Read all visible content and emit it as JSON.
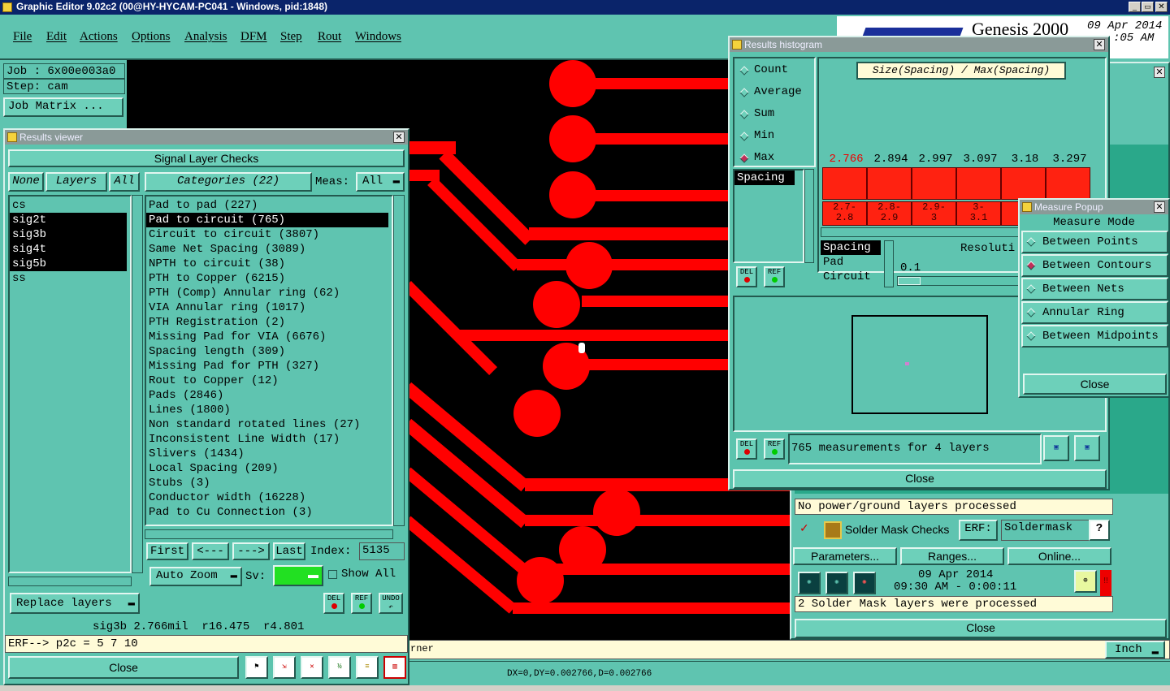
{
  "app": {
    "title": "Graphic Editor 9.02c2 (00@HY-HYCAM-PC041 - Windows, pid:1848)",
    "menu": [
      "File",
      "Edit",
      "Actions",
      "Options",
      "Analysis",
      "DFM",
      "Step",
      "Rout",
      "Windows"
    ],
    "brand": "Genesis 2000",
    "date": "09 Apr 2014",
    "time": ":05 AM",
    "job": "Job : 6x00e003a0",
    "step": "Step: cam",
    "job_matrix": "Job Matrix ...",
    "status_corner": "rner",
    "status_coords": "DX=0,DY=0.002766,D=0.002766",
    "units": "Inch"
  },
  "results_viewer": {
    "title": "Results viewer",
    "header": "Signal Layer Checks",
    "tabs": {
      "none": "None",
      "layers": "Layers",
      "all": "All"
    },
    "categories_label": "Categories (22)",
    "meas_label": "Meas:",
    "meas_value": "All",
    "layers": [
      {
        "name": "cs",
        "selected": false
      },
      {
        "name": "sig2t",
        "selected": true
      },
      {
        "name": "sig3b",
        "selected": true
      },
      {
        "name": "sig4t",
        "selected": true
      },
      {
        "name": "sig5b",
        "selected": true
      },
      {
        "name": "ss",
        "selected": false
      }
    ],
    "categories": [
      {
        "name": "Pad to pad (227)",
        "selected": false
      },
      {
        "name": "Pad to circuit (765)",
        "selected": true
      },
      {
        "name": "Circuit to circuit (3807)",
        "selected": false
      },
      {
        "name": "Same Net Spacing (3089)",
        "selected": false
      },
      {
        "name": "NPTH to circuit (38)",
        "selected": false
      },
      {
        "name": "PTH to Copper (6215)",
        "selected": false
      },
      {
        "name": "PTH (Comp) Annular ring (62)",
        "selected": false
      },
      {
        "name": "VIA Annular ring (1017)",
        "selected": false
      },
      {
        "name": "PTH Registration (2)",
        "selected": false
      },
      {
        "name": "Missing Pad for VIA (6676)",
        "selected": false
      },
      {
        "name": "Spacing length (309)",
        "selected": false
      },
      {
        "name": "Missing Pad for PTH (327)",
        "selected": false
      },
      {
        "name": "Rout to Copper (12)",
        "selected": false
      },
      {
        "name": "Pads (2846)",
        "selected": false
      },
      {
        "name": "Lines (1800)",
        "selected": false
      },
      {
        "name": "Non standard rotated lines (27)",
        "selected": false
      },
      {
        "name": "Inconsistent Line Width (17)",
        "selected": false
      },
      {
        "name": "Slivers (1434)",
        "selected": false
      },
      {
        "name": "Local Spacing (209)",
        "selected": false
      },
      {
        "name": "Stubs (3)",
        "selected": false
      },
      {
        "name": "Conductor width (16228)",
        "selected": false
      },
      {
        "name": "Pad to Cu Connection (3)",
        "selected": false
      }
    ],
    "nav": {
      "first": "First",
      "prev": "<---",
      "next": "--->",
      "last": "Last",
      "index_label": "Index:",
      "index_value": "5135"
    },
    "auto_zoom": "Auto Zoom",
    "sv_label": "Sv:",
    "show_all": "Show All",
    "replace_layers": "Replace layers",
    "del": "DEL",
    "ref": "REF",
    "undo": "UNDO",
    "status": "sig3b 2.766mil  r16.475  r4.801",
    "erf": "ERF--> p2c = 5 7 10",
    "close": "Close"
  },
  "histogram": {
    "title": "Results histogram",
    "modes": [
      {
        "label": "Count",
        "on": false
      },
      {
        "label": "Average",
        "on": false
      },
      {
        "label": "Sum",
        "on": false
      },
      {
        "label": "Min",
        "on": false
      },
      {
        "label": "Max",
        "on": true
      }
    ],
    "list_item": "Spacing",
    "chart_title": "Size(Spacing) / Max(Spacing)",
    "bar_values": [
      "2.766",
      "2.894",
      "2.997",
      "3.097",
      "3.18",
      "3.297"
    ],
    "bins": [
      [
        "2.7-",
        "2.8"
      ],
      [
        "2.8-",
        "2.9"
      ],
      [
        "2.9-",
        "3"
      ],
      [
        "3-",
        "3.1"
      ],
      [
        "3",
        ""
      ]
    ],
    "measures": [
      "Spacing",
      "Pad",
      "Circuit"
    ],
    "resolution_label": "Resoluti",
    "resolution_value": "0.1",
    "summary": "765 measurements for 4 layers",
    "close": "Close"
  },
  "measure_popup": {
    "title": "Measure Popup",
    "header": "Measure Mode",
    "options": [
      {
        "label": "Between Points",
        "on": false
      },
      {
        "label": "Between Contours",
        "on": true
      },
      {
        "label": "Between Nets",
        "on": false
      },
      {
        "label": "Annular Ring",
        "on": false
      },
      {
        "label": "Between Midpoints",
        "on": false
      }
    ],
    "close": "Close"
  },
  "dfm_panel": {
    "status1": "No power/ground layers processed",
    "check_label": "Solder Mask Checks",
    "erf_label": "ERF:",
    "erf_value": "Soldermask",
    "help": "?",
    "parameters": "Parameters...",
    "ranges": "Ranges...",
    "online": "Online...",
    "run_date": "09 Apr 2014",
    "run_time": "09:30 AM - 0:00:11",
    "status2": "2 Solder Mask layers were processed",
    "close": "Close",
    "warn": "!!"
  }
}
